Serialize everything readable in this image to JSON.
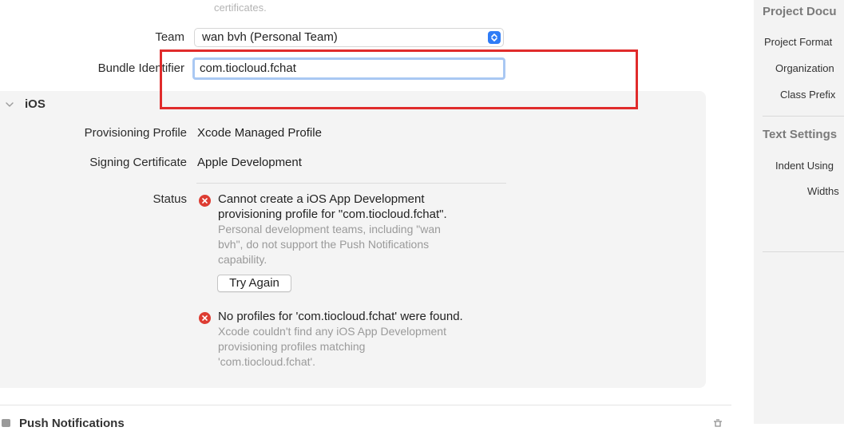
{
  "signing": {
    "certificates_note": "certificates.",
    "team_label": "Team",
    "team_value": "wan bvh (Personal Team)",
    "bundle_label": "Bundle Identifier",
    "bundle_value": "com.tiocloud.fchat"
  },
  "ios": {
    "title": "iOS",
    "provisioning_label": "Provisioning Profile",
    "provisioning_value": "Xcode Managed Profile",
    "signing_cert_label": "Signing Certificate",
    "signing_cert_value": "Apple Development",
    "status_label": "Status",
    "errors": [
      {
        "main": [
          "Cannot create a iOS App Development",
          "provisioning profile for \"com.tiocloud.fchat\"."
        ],
        "sub": [
          "Personal development teams, including \"wan",
          "bvh\", do not support the Push Notifications",
          "capability."
        ]
      },
      {
        "main": [
          "No profiles for 'com.tiocloud.fchat' were found."
        ],
        "sub": [
          "Xcode couldn't find any iOS App Development",
          "provisioning profiles matching",
          "'com.tiocloud.fchat'."
        ]
      }
    ],
    "try_again_label": "Try Again"
  },
  "next_section": {
    "title": "Push Notifications"
  },
  "inspector": {
    "project_document_heading": "Project Docu",
    "project_format_label": "Project Format",
    "organization_label": "Organization",
    "class_prefix_label": "Class Prefix",
    "text_settings_heading": "Text Settings",
    "indent_using_label": "Indent Using",
    "widths_label": "Widths"
  },
  "colors": {
    "error_red": "#dd3c32",
    "annotation_red": "#e02b2b",
    "accent_blue": "#2f7cf6",
    "focus_ring": "#a9c8f3"
  }
}
